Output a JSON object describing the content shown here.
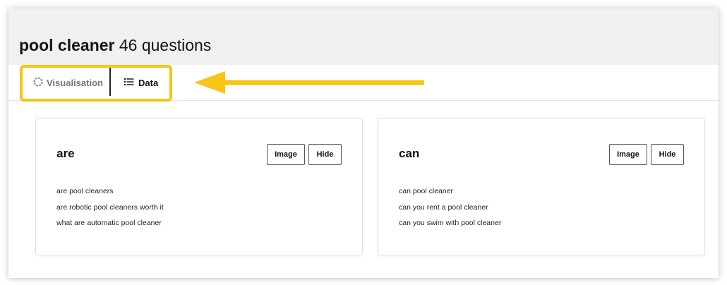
{
  "header": {
    "keyword": "pool cleaner",
    "count_text": "46 questions"
  },
  "tabs": [
    {
      "label": "Visualisation",
      "icon": "loading-circle-icon",
      "active": false
    },
    {
      "label": "Data",
      "icon": "list-icon",
      "active": true
    }
  ],
  "annotation": {
    "highlight_color": "#f7c515",
    "arrow_color": "#f7c515"
  },
  "cards": [
    {
      "title": "are",
      "image_label": "Image",
      "hide_label": "Hide",
      "questions": [
        "are pool cleaners",
        "are robotic pool cleaners worth it",
        "what are automatic pool cleaner"
      ]
    },
    {
      "title": "can",
      "image_label": "Image",
      "hide_label": "Hide",
      "questions": [
        "can pool cleaner",
        "can you rent a pool cleaner",
        "can you swim with pool cleaner"
      ]
    }
  ]
}
